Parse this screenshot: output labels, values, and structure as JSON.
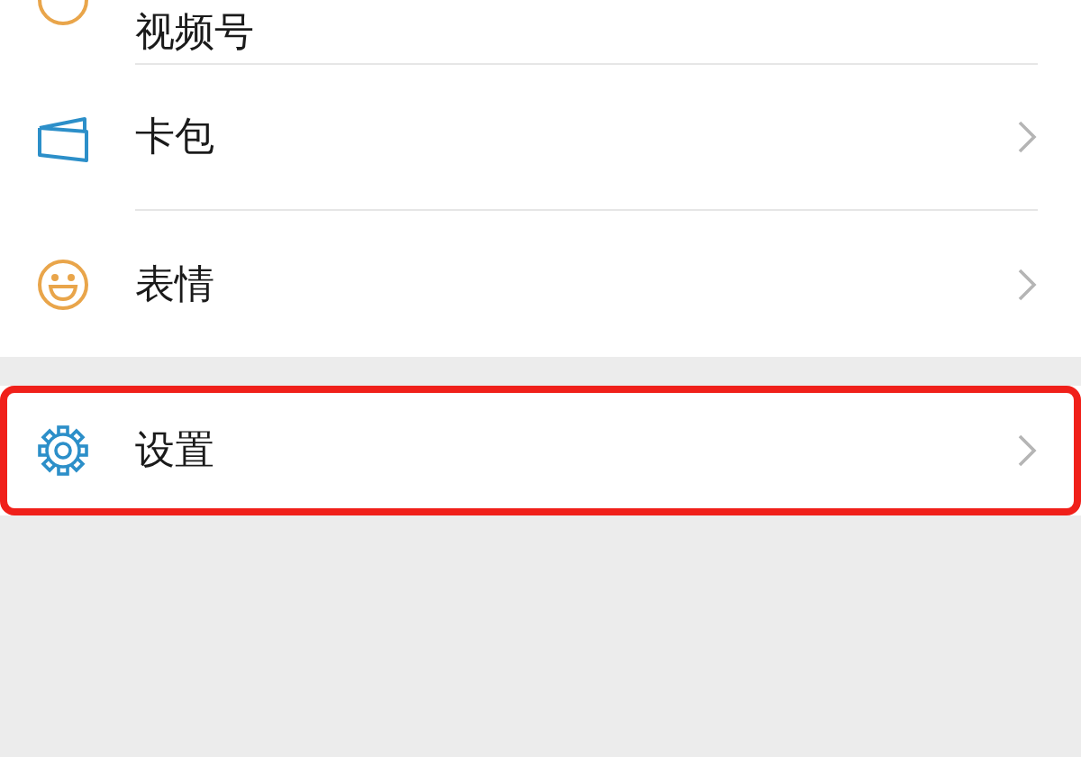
{
  "groups": [
    {
      "items": [
        {
          "kind": "channels",
          "label": "视频号",
          "highlighted": false
        },
        {
          "kind": "cards",
          "label": "卡包",
          "highlighted": false
        },
        {
          "kind": "stickers",
          "label": "表情",
          "highlighted": false
        }
      ]
    },
    {
      "items": [
        {
          "kind": "settings",
          "label": "设置",
          "highlighted": true
        }
      ]
    }
  ]
}
